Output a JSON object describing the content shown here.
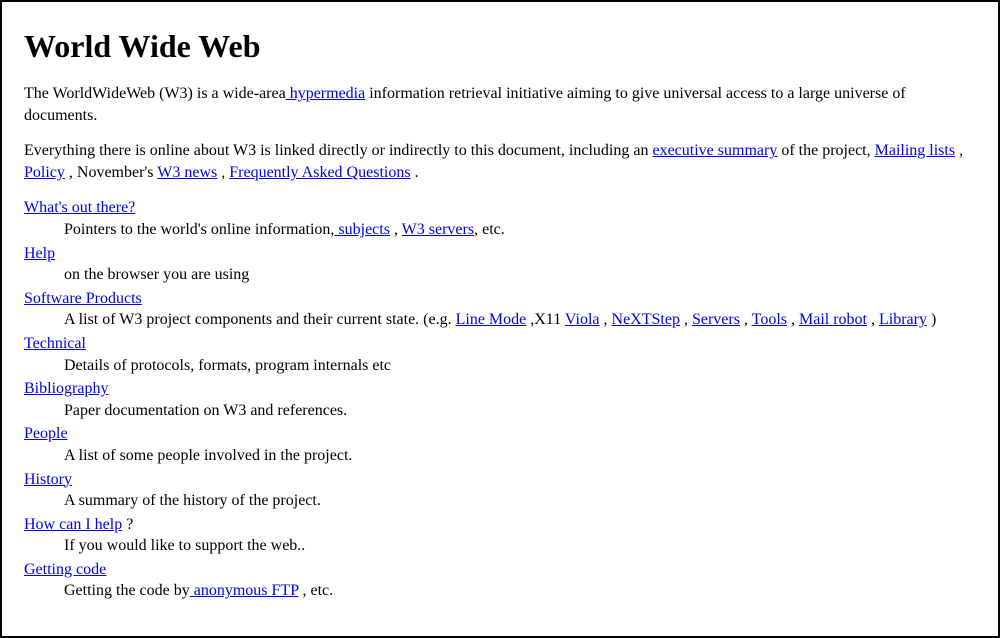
{
  "title": "World Wide Web",
  "para1": {
    "t1": "The WorldWideWeb (W3) is a wide-area",
    "link_hypermedia": " hypermedia",
    "t2": " information retrieval initiative aiming to give universal access to a large universe of documents."
  },
  "para2": {
    "t1": "Everything there is online about W3 is linked directly or indirectly to this document, including an ",
    "link_exec_summary": "executive summary",
    "t2": " of the project, ",
    "link_mailing_lists": "Mailing lists",
    "t3": " , ",
    "link_policy": "Policy",
    "t4": " , November's ",
    "link_w3_news": "W3 news",
    "t5": " , ",
    "link_faq": "Frequently Asked Questions",
    "t6": " ."
  },
  "items": {
    "whats_out_there": {
      "term": "What's out there?",
      "desc_t1": "Pointers to the world's online information,",
      "desc_link_subjects": " subjects",
      "desc_t2": " , ",
      "desc_link_w3_servers": "W3 servers",
      "desc_t3": ", etc."
    },
    "help": {
      "term": "Help",
      "desc": "on the browser you are using"
    },
    "software_products": {
      "term": "Software Products",
      "desc_t1": "A list of W3 project components and their current state. (e.g. ",
      "link_line_mode": "Line Mode",
      "t2": " ,X11 ",
      "link_viola": "Viola",
      "t3": " , ",
      "link_nextstep": "NeXTStep",
      "t4": " , ",
      "link_servers": "Servers",
      "t5": " , ",
      "link_tools": "Tools",
      "t6": " , ",
      "link_mail_robot": "Mail robot",
      "t7": " , ",
      "link_library": "Library",
      "t8": " )"
    },
    "technical": {
      "term": "Technical",
      "desc": "Details of protocols, formats, program internals etc"
    },
    "bibliography": {
      "term": "Bibliography",
      "desc": "Paper documentation on W3 and references."
    },
    "people": {
      "term": "People",
      "desc": "A list of some people involved in the project."
    },
    "history": {
      "term": "History",
      "desc": "A summary of the history of the project."
    },
    "how_can_i_help": {
      "term": "How can I help",
      "term_suffix": " ?",
      "desc": "If you would like to support the web.."
    },
    "getting_code": {
      "term": "Getting code",
      "desc_t1": "Getting the code by",
      "link_anon_ftp": " anonymous FTP",
      "desc_t2": " , etc."
    }
  }
}
